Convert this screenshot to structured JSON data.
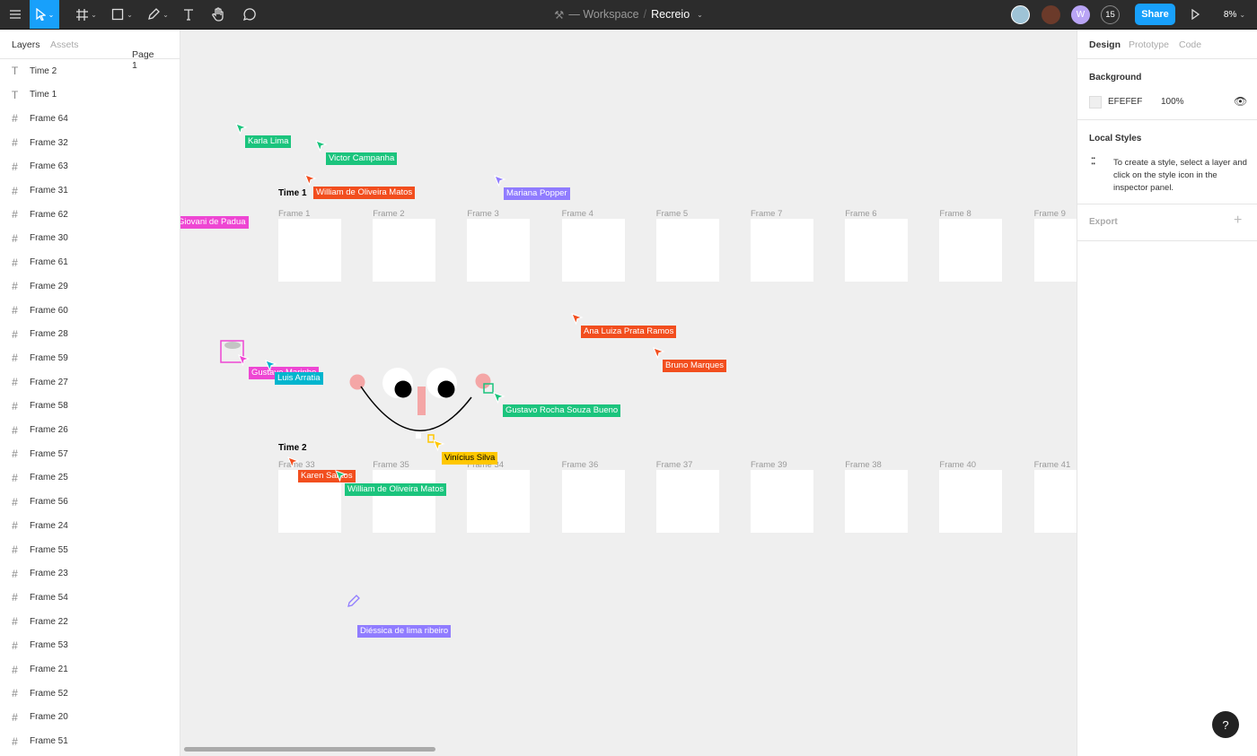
{
  "toolbar": {
    "tools": [
      "menu-icon",
      "move-tool",
      "frame-tool",
      "shape-tool",
      "pen-tool",
      "text-tool",
      "hand-tool",
      "comment-tool"
    ],
    "breadcrumb_workspace": "— Workspace",
    "separator": "/",
    "file_name": "Recreio",
    "collaborators_count": "15",
    "avatar_initial": "W",
    "share_label": "Share",
    "zoom": "8%",
    "accent": "#18a0fb"
  },
  "left_panel": {
    "tabs": [
      "Layers",
      "Assets"
    ],
    "page": "Page 1",
    "layers": [
      {
        "type": "text",
        "name": "Time 2"
      },
      {
        "type": "text",
        "name": "Time 1"
      },
      {
        "type": "frame",
        "name": "Frame 64"
      },
      {
        "type": "frame",
        "name": "Frame 32"
      },
      {
        "type": "frame",
        "name": "Frame 63"
      },
      {
        "type": "frame",
        "name": "Frame 31"
      },
      {
        "type": "frame",
        "name": "Frame 62"
      },
      {
        "type": "frame",
        "name": "Frame 30"
      },
      {
        "type": "frame",
        "name": "Frame 61"
      },
      {
        "type": "frame",
        "name": "Frame 29"
      },
      {
        "type": "frame",
        "name": "Frame 60"
      },
      {
        "type": "frame",
        "name": "Frame 28"
      },
      {
        "type": "frame",
        "name": "Frame 59"
      },
      {
        "type": "frame",
        "name": "Frame 27"
      },
      {
        "type": "frame",
        "name": "Frame 58"
      },
      {
        "type": "frame",
        "name": "Frame 26"
      },
      {
        "type": "frame",
        "name": "Frame 57"
      },
      {
        "type": "frame",
        "name": "Frame 25"
      },
      {
        "type": "frame",
        "name": "Frame 56"
      },
      {
        "type": "frame",
        "name": "Frame 24"
      },
      {
        "type": "frame",
        "name": "Frame 55"
      },
      {
        "type": "frame",
        "name": "Frame 23"
      },
      {
        "type": "frame",
        "name": "Frame 54"
      },
      {
        "type": "frame",
        "name": "Frame 22"
      },
      {
        "type": "frame",
        "name": "Frame 53"
      },
      {
        "type": "frame",
        "name": "Frame 21"
      },
      {
        "type": "frame",
        "name": "Frame 52"
      },
      {
        "type": "frame",
        "name": "Frame 20"
      },
      {
        "type": "frame",
        "name": "Frame 51"
      }
    ]
  },
  "right_panel": {
    "tabs": [
      "Design",
      "Prototype",
      "Code"
    ],
    "background_title": "Background",
    "background_hex": "EFEFEF",
    "background_opacity": "100%",
    "local_styles_title": "Local Styles",
    "local_styles_hint": "To create a style, select a layer and click on the style icon in the inspector panel.",
    "export_title": "Export",
    "add": "+"
  },
  "canvas": {
    "group1": "Time 1",
    "group2": "Time 2",
    "row1": [
      "Frame 1",
      "Frame 2",
      "Frame 3",
      "Frame 4",
      "Frame 5",
      "Frame 7",
      "Frame 6",
      "Frame 8",
      "Frame 9"
    ],
    "row2": [
      "Frame 33",
      "Frame 35",
      "Frame 34",
      "Frame 36",
      "Frame 37",
      "Frame 39",
      "Frame 38",
      "Frame 40",
      "Frame 41"
    ],
    "cursors": [
      {
        "name": "Karla Lima",
        "color": "#1bc47d"
      },
      {
        "name": "Victor Campanha",
        "color": "#1bc47d"
      },
      {
        "name": "William de Oliveira Matos",
        "color": "#f24e1e"
      },
      {
        "name": "Mariana Popper",
        "color": "#907cff"
      },
      {
        "name": "Giovani de Padua",
        "color": "#ee46d3"
      },
      {
        "name": "Ana Luiza Prata Ramos",
        "color": "#f24e1e"
      },
      {
        "name": "Bruno Marques",
        "color": "#f24e1e"
      },
      {
        "name": "Gustavo Marinho",
        "color": "#ee46d3"
      },
      {
        "name": "Luis Arratia",
        "color": "#00b5ce"
      },
      {
        "name": "Gustavo Rocha Souza Bueno",
        "color": "#1bc47d"
      },
      {
        "name": "Vinícius Silva",
        "color": "#ffc700"
      },
      {
        "name": "Karen Santos",
        "color": "#f24e1e"
      },
      {
        "name": "William de Oliveira Matos",
        "color": "#1bc47d"
      },
      {
        "name": "Diéssica de lima ribeiro",
        "color": "#907cff"
      }
    ]
  },
  "help": "?"
}
